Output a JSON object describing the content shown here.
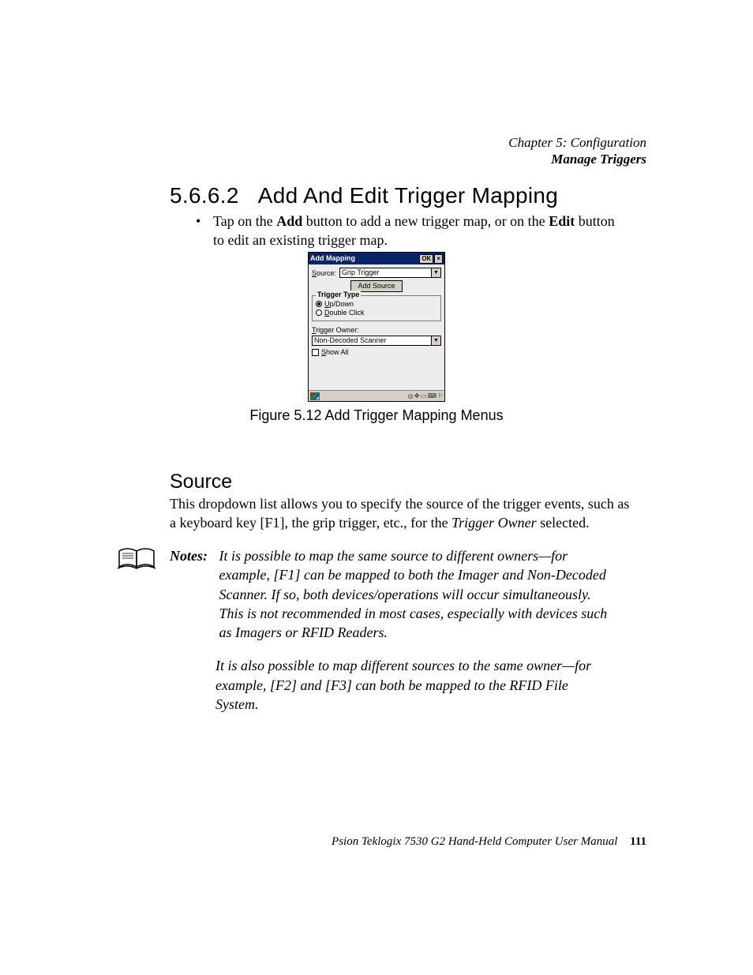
{
  "runningHead": {
    "chapter": "Chapter 5: Configuration",
    "section": "Manage Triggers"
  },
  "heading": {
    "number": "5.6.6.2",
    "title": "Add And Edit Trigger Mapping"
  },
  "intro": {
    "pre": "Tap on the ",
    "b1": "Add",
    "mid": " button to add a new trigger map, or on the ",
    "b2": "Edit",
    "post": " button to edit an existing trigger map."
  },
  "figureCaption": "Figure 5.12 Add Trigger Mapping Menus",
  "dialog": {
    "title": "Add Mapping",
    "ok": "OK",
    "close": "×",
    "sourceLabelU": "S",
    "sourceLabelRest": "ource:",
    "sourceValue": "Grip Trigger",
    "addSource": "Add Source",
    "triggerTypeLegend": "Trigger Type",
    "radio1U": "U",
    "radio1Rest": "p/Down",
    "radio2U": "D",
    "radio2Rest": "ouble Click",
    "ownerLabelU": "T",
    "ownerLabelRest": "rigger Owner:",
    "ownerValue": "Non-Decoded Scanner",
    "showAllU": "S",
    "showAllRest": "how All",
    "tray": "◎ ✥ ▭ ⌨ ⚐"
  },
  "sourceHeading": "Source",
  "sourcePara": {
    "pre": "This dropdown list allows you to specify the source of the trigger events, such as a keyboard key [F1], the grip trigger, etc., for the ",
    "em": "Trigger Owner",
    "post": " selected."
  },
  "notes": {
    "label": "Notes:",
    "p1": "It is possible to map the same source to different owners—for example, [F1] can be mapped to both the Imager and Non-Decoded Scanner. If so, both devices/operations will occur simultaneously. This is not recommended in most cases, especially with devices such as Imagers or RFID Readers.",
    "p2": "It is also possible to map different sources to the same owner—for example, [F2] and [F3] can both be mapped to the RFID File System."
  },
  "footer": {
    "text": "Psion Teklogix 7530 G2 Hand-Held Computer User Manual",
    "page": "111"
  }
}
